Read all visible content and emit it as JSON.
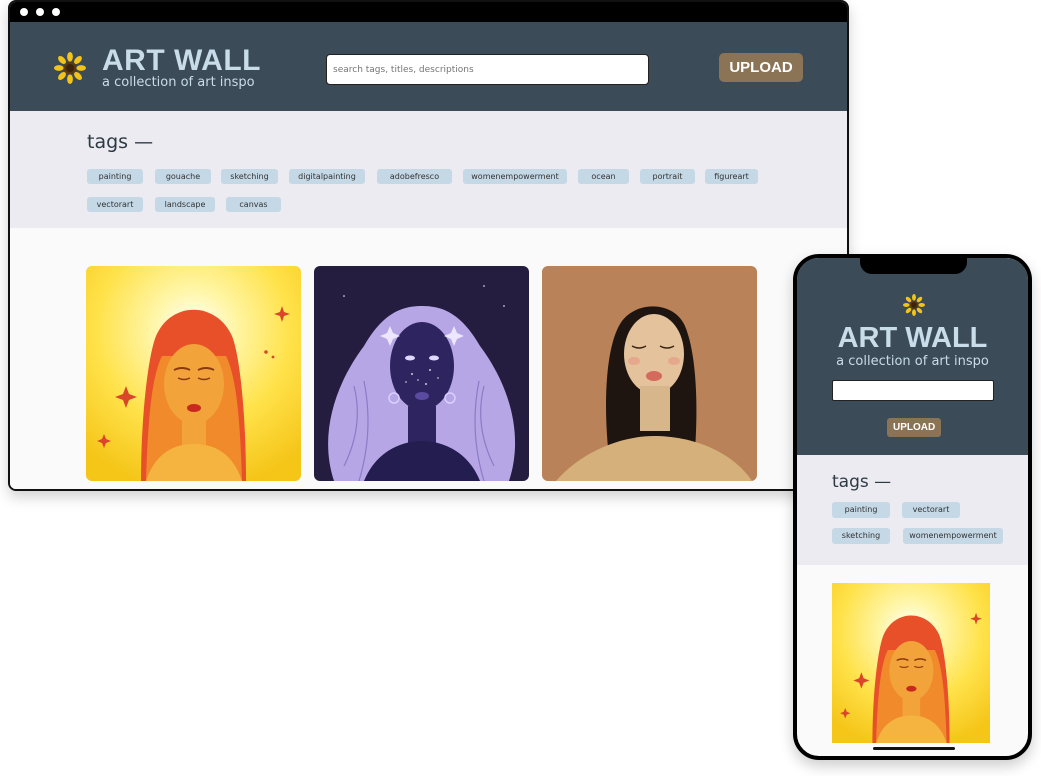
{
  "brand": {
    "title": "ART WALL",
    "subtitle": "a collection of art inspo"
  },
  "search": {
    "placeholder": "search tags, titles, descriptions"
  },
  "upload": {
    "label": "UPLOAD"
  },
  "tags": {
    "title": "tags —",
    "desktop": [
      "painting",
      "gouache",
      "sketching",
      "digitalpainting",
      "adobefresco",
      "womenempowerment",
      "ocean",
      "portrait",
      "figureart",
      "vectorart",
      "landscape",
      "canvas"
    ],
    "mobile": [
      "painting",
      "vectorart",
      "sketching",
      "womenempowerment"
    ]
  },
  "colors": {
    "header": "#3c4b58",
    "brand_text": "#c8dcea",
    "upload": "#8b7355",
    "tag_chip": "#c5d8e6",
    "tags_bg": "#ebebf1"
  },
  "artworks": [
    {
      "name": "sun-woman-portrait",
      "palette": "yellow"
    },
    {
      "name": "starry-purple-portrait",
      "palette": "purple"
    },
    {
      "name": "brown-background-portrait",
      "palette": "brown"
    }
  ],
  "icons": {
    "logo": "sunflower-icon"
  }
}
